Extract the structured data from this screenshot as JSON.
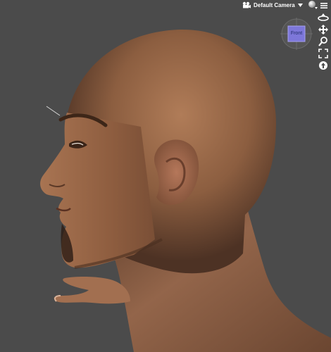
{
  "viewport": {
    "camera_label": "Default Camera",
    "cube_face_label": "Front",
    "background_color": "#4b4b4b",
    "skin_color": "#9c6a4a"
  },
  "toolbar": {
    "icons": [
      "camera-icon",
      "dropdown-arrow-icon",
      "shading-sphere-icon",
      "menu-icon"
    ]
  },
  "nav_tools": [
    "orbit-icon",
    "pan-icon",
    "zoom-icon",
    "frame-icon",
    "reset-icon"
  ]
}
